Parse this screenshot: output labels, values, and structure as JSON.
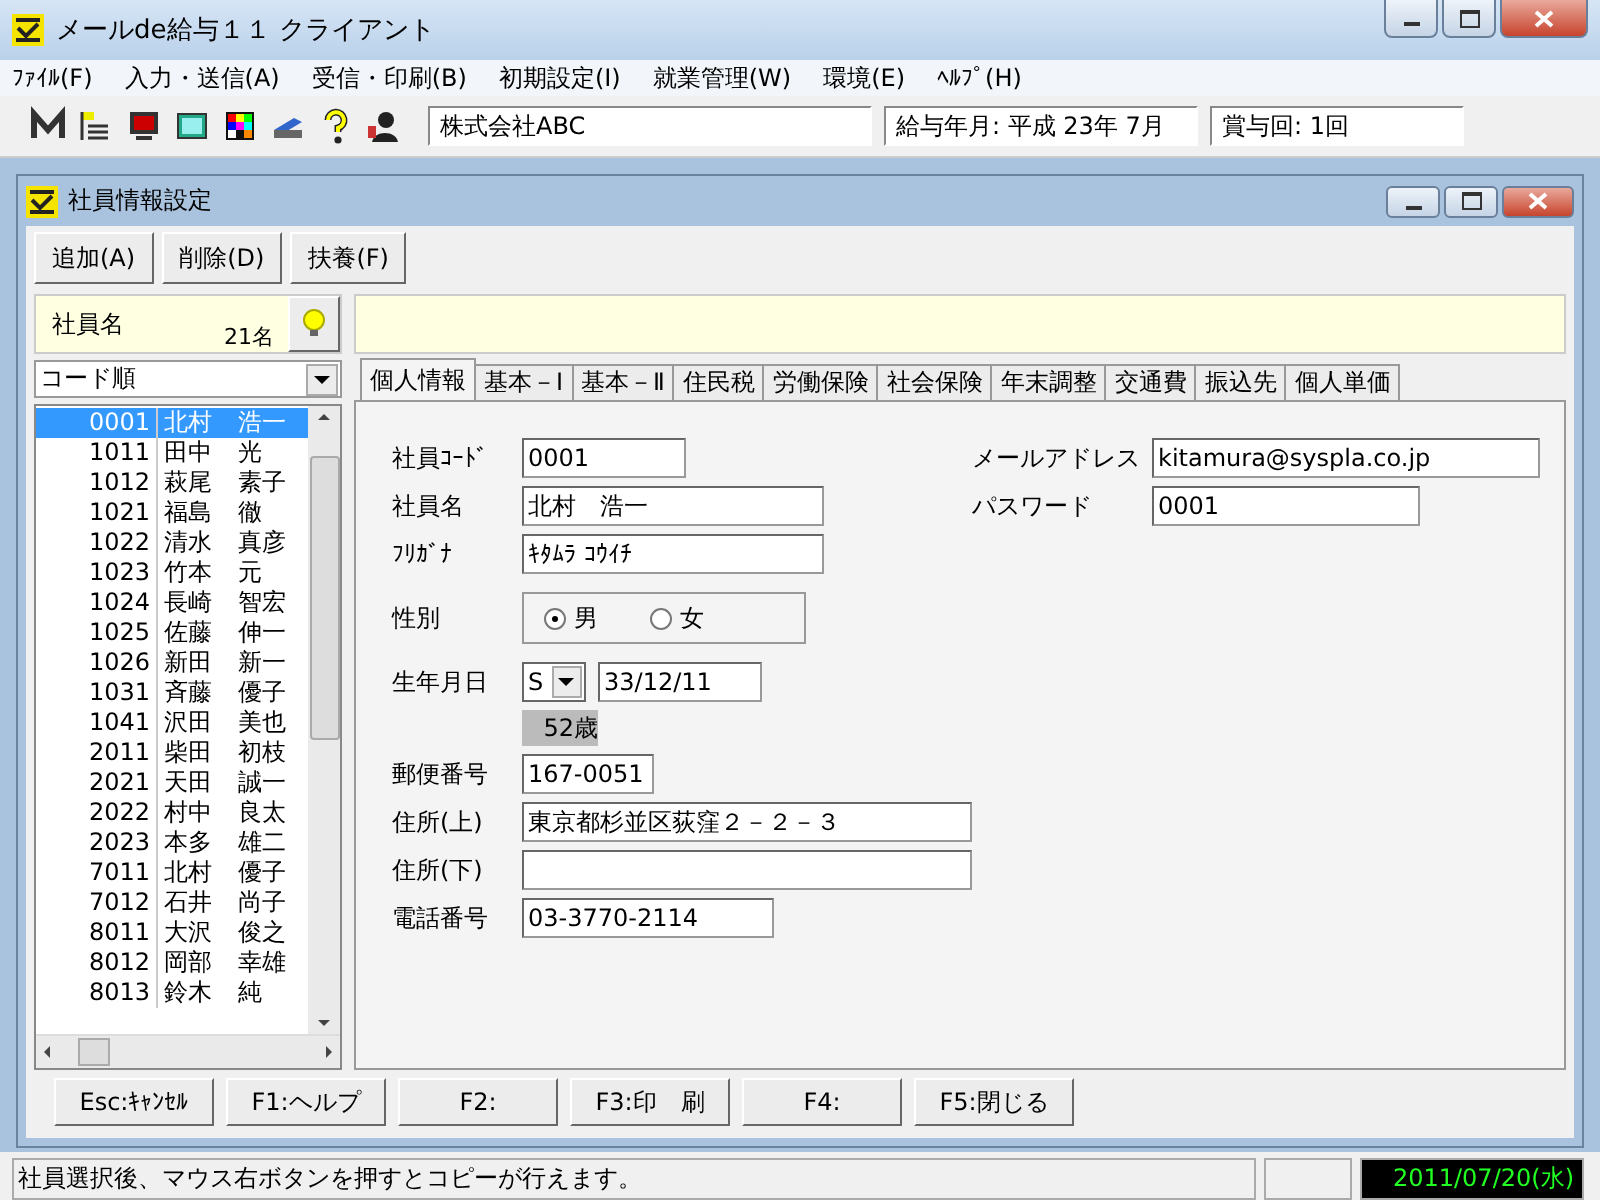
{
  "window": {
    "title": "メールde給与１１ クライアント"
  },
  "menu": [
    "ﾌｧｲﾙ(F)",
    "入力・送信(A)",
    "受信・印刷(B)",
    "初期設定(I)",
    "就業管理(W)",
    "環境(E)",
    "ﾍﾙﾌﾟ(H)"
  ],
  "toolbar": {
    "company": "株式会社ABC",
    "pay_month": "給与年月: 平成 23年  7月",
    "bonus": "賞与回: 1回"
  },
  "child": {
    "title": "社員情報設定",
    "buttons": [
      "追加(A)",
      "削除(D)",
      "扶養(F)"
    ],
    "employees": {
      "heading": "社員名",
      "count": "21名",
      "sort": "コード順",
      "list": [
        {
          "code": "0001",
          "last": "北村",
          "first": "浩一",
          "selected": true
        },
        {
          "code": "1011",
          "last": "田中",
          "first": "光",
          "selected": false
        },
        {
          "code": "1012",
          "last": "萩尾",
          "first": "素子",
          "selected": false
        },
        {
          "code": "1021",
          "last": "福島",
          "first": "徹",
          "selected": false
        },
        {
          "code": "1022",
          "last": "清水",
          "first": "真彦",
          "selected": false
        },
        {
          "code": "1023",
          "last": "竹本",
          "first": "元",
          "selected": false
        },
        {
          "code": "1024",
          "last": "長崎",
          "first": "智宏",
          "selected": false
        },
        {
          "code": "1025",
          "last": "佐藤",
          "first": "伸一",
          "selected": false
        },
        {
          "code": "1026",
          "last": "新田",
          "first": "新一",
          "selected": false
        },
        {
          "code": "1031",
          "last": "斉藤",
          "first": "優子",
          "selected": false
        },
        {
          "code": "1041",
          "last": "沢田",
          "first": "美也",
          "selected": false
        },
        {
          "code": "2011",
          "last": "柴田",
          "first": "初枝",
          "selected": false
        },
        {
          "code": "2021",
          "last": "天田",
          "first": "誠一",
          "selected": false
        },
        {
          "code": "2022",
          "last": "村中",
          "first": "良太",
          "selected": false
        },
        {
          "code": "2023",
          "last": "本多",
          "first": "雄二",
          "selected": false
        },
        {
          "code": "7011",
          "last": "北村",
          "first": "優子",
          "selected": false
        },
        {
          "code": "7012",
          "last": "石井",
          "first": "尚子",
          "selected": false
        },
        {
          "code": "8011",
          "last": "大沢",
          "first": "俊之",
          "selected": false
        },
        {
          "code": "8012",
          "last": "岡部",
          "first": "幸雄",
          "selected": false
        },
        {
          "code": "8013",
          "last": "鈴木",
          "first": "純",
          "selected": false
        }
      ]
    },
    "tabs": [
      {
        "label": "個人情報",
        "selected": true
      },
      {
        "label": "基本－Ⅰ",
        "selected": false
      },
      {
        "label": "基本－Ⅱ",
        "selected": false
      },
      {
        "label": "住民税",
        "selected": false
      },
      {
        "label": "労働保険",
        "selected": false
      },
      {
        "label": "社会保険",
        "selected": false
      },
      {
        "label": "年末調整",
        "selected": false
      },
      {
        "label": "交通費",
        "selected": false
      },
      {
        "label": "振込先",
        "selected": false
      },
      {
        "label": "個人単価",
        "selected": false
      }
    ],
    "fields_top": [
      {
        "label": "社員ｺｰﾄﾞ",
        "value": "0001"
      },
      {
        "label": "社員名",
        "value": "北村　浩一"
      },
      {
        "label": "ﾌﾘｶﾞﾅ",
        "value": "ｷﾀﾑﾗ ｺｳｲﾁ"
      }
    ],
    "fields_right": [
      {
        "label": "メールアドレス",
        "value": "kitamura@syspla.co.jp"
      },
      {
        "label": "パスワード",
        "value": "0001"
      }
    ],
    "gender": {
      "label": "性別",
      "options": [
        {
          "label": "男",
          "selected": true
        },
        {
          "label": "女",
          "selected": false
        }
      ]
    },
    "birth": {
      "label": "生年月日",
      "era": "S",
      "date": "33/12/11",
      "age": "52歳"
    },
    "fields_bottom": [
      {
        "label": "郵便番号",
        "value": "167-0051"
      },
      {
        "label": "住所(上)",
        "value": "東京都杉並区荻窪２－２－３"
      },
      {
        "label": "住所(下)"
      },
      {
        "label": "電話番号",
        "value": "03-3770-2114"
      }
    ],
    "function_keys": [
      "Esc:ｷｬﾝｾﾙ",
      "F1:ヘルプ",
      "F2:",
      "F3:印　刷",
      "F4:",
      "F5:閉じる"
    ]
  },
  "status_bar": {
    "message": "社員選択後、マウス右ボタンを押すとコピーが行えます。",
    "date": "2011/07/20(水)"
  }
}
